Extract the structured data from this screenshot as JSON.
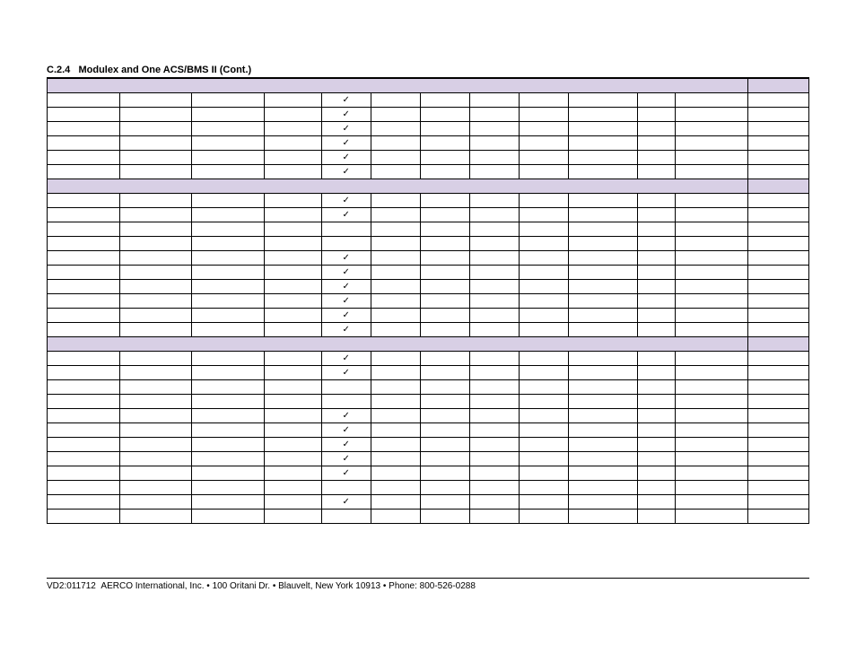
{
  "section": {
    "number": "C.2.4",
    "title": "Modulex  and One ACS/BMS II (Cont.)"
  },
  "checkmark": "✓",
  "rows": [
    {
      "type": "shaded"
    },
    {
      "type": "data",
      "check": true
    },
    {
      "type": "data",
      "check": true
    },
    {
      "type": "data",
      "check": true
    },
    {
      "type": "data",
      "check": true
    },
    {
      "type": "data",
      "check": true
    },
    {
      "type": "data",
      "check": true
    },
    {
      "type": "shaded"
    },
    {
      "type": "data",
      "check": true
    },
    {
      "type": "data",
      "check": true
    },
    {
      "type": "data",
      "check": false
    },
    {
      "type": "data",
      "check": false
    },
    {
      "type": "data",
      "check": true
    },
    {
      "type": "data",
      "check": true
    },
    {
      "type": "data",
      "check": true
    },
    {
      "type": "data",
      "check": true
    },
    {
      "type": "data",
      "check": true
    },
    {
      "type": "data",
      "check": true
    },
    {
      "type": "shaded"
    },
    {
      "type": "data",
      "check": true
    },
    {
      "type": "data",
      "check": true
    },
    {
      "type": "data",
      "check": false
    },
    {
      "type": "data",
      "check": false
    },
    {
      "type": "data",
      "check": true
    },
    {
      "type": "data",
      "check": true
    },
    {
      "type": "data",
      "check": true
    },
    {
      "type": "data",
      "check": true
    },
    {
      "type": "data",
      "check": true
    },
    {
      "type": "data",
      "check": false
    },
    {
      "type": "data",
      "check": true
    },
    {
      "type": "data",
      "check": false
    }
  ],
  "footer": {
    "doc_id": "VD2:011712",
    "company": "AERCO International, Inc.",
    "address": "100 Oritani Dr.",
    "city": "Blauvelt, New York 10913",
    "phone_label": "Phone:",
    "phone": "800-526-0288"
  }
}
